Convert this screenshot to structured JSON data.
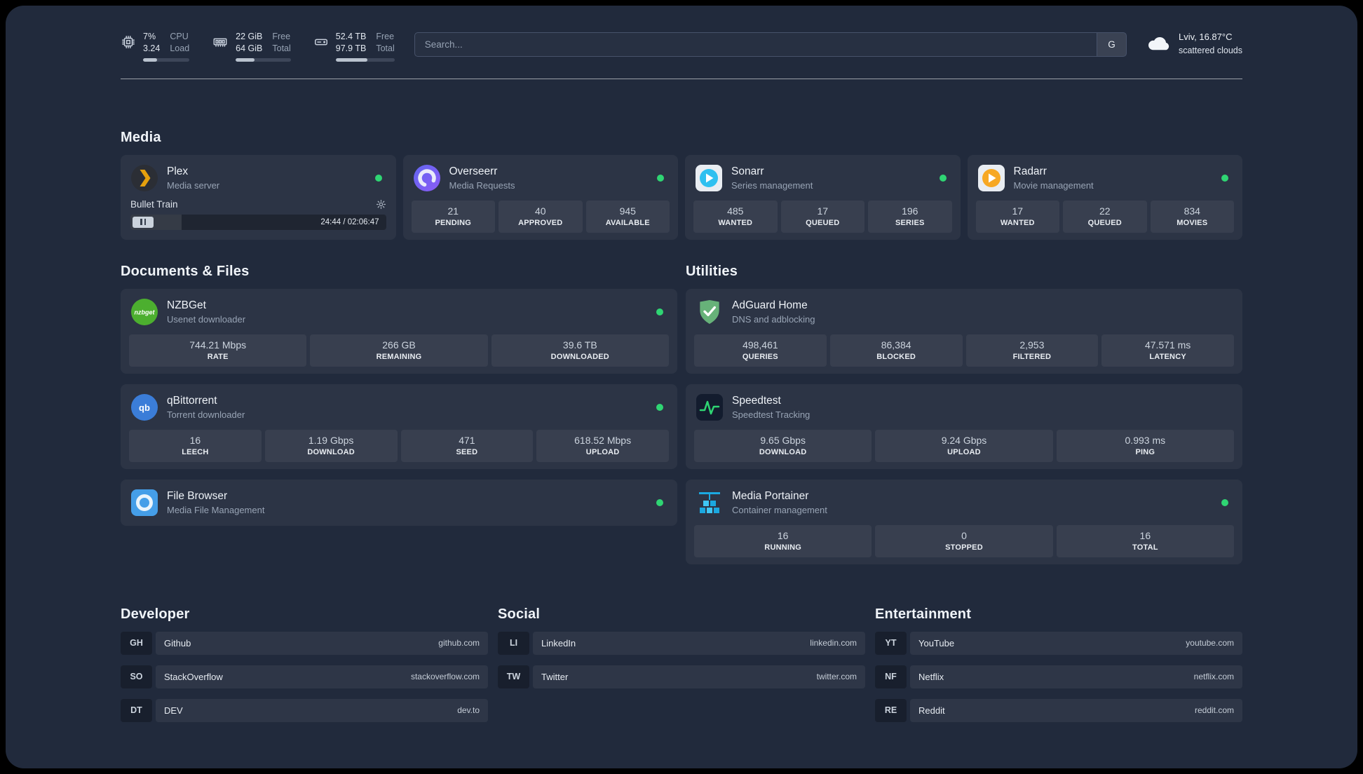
{
  "colors": {
    "status_online": "#2fd573",
    "page_background": "#212a3c",
    "plex_accent": "#e5a00d",
    "sonarr_accent": "#2ec0f0",
    "radarr_accent": "#f7a823",
    "nzbget_accent": "#4caf2f",
    "qbittorrent_accent": "#3b7dd8",
    "adguard_accent": "#67b279",
    "speedtest_accent": "#2fd573",
    "portainer_accent": "#1ba8e0"
  },
  "topbar": {
    "cpu": {
      "icon": "cpu-chip-icon",
      "value_top": "7%",
      "value_bottom": "3.24",
      "label_top": "CPU",
      "label_bottom": "Load",
      "bar_percent": 30
    },
    "memory": {
      "icon": "memory-icon",
      "value_top": "22 GiB",
      "value_bottom": "64 GiB",
      "label_top": "Free",
      "label_bottom": "Total",
      "bar_percent": 34
    },
    "disk": {
      "icon": "hard-drive-icon",
      "value_top": "52.4 TB",
      "value_bottom": "97.9 TB",
      "label_top": "Free",
      "label_bottom": "Total",
      "bar_percent": 54
    },
    "search": {
      "placeholder": "Search...",
      "provider_label": "G"
    },
    "weather": {
      "icon": "cloud-icon",
      "location": "Lviv, 16.87°C",
      "condition": "scattered clouds"
    }
  },
  "groups": {
    "media": {
      "title": "Media",
      "services": [
        {
          "name": "Plex",
          "subtitle": "Media server",
          "icon": "plex-icon",
          "status": "online",
          "player": {
            "title": "Bullet Train",
            "time": "24:44 / 02:06:47",
            "progress_percent": 20
          }
        },
        {
          "name": "Overseerr",
          "subtitle": "Media Requests",
          "icon": "overseerr-icon",
          "status": "online",
          "stats": [
            {
              "value": "21",
              "label": "PENDING"
            },
            {
              "value": "40",
              "label": "APPROVED"
            },
            {
              "value": "945",
              "label": "AVAILABLE"
            }
          ]
        },
        {
          "name": "Sonarr",
          "subtitle": "Series management",
          "icon": "sonarr-icon",
          "status": "online",
          "stats": [
            {
              "value": "485",
              "label": "WANTED"
            },
            {
              "value": "17",
              "label": "QUEUED"
            },
            {
              "value": "196",
              "label": "SERIES"
            }
          ]
        },
        {
          "name": "Radarr",
          "subtitle": "Movie management",
          "icon": "radarr-icon",
          "status": "online",
          "stats": [
            {
              "value": "17",
              "label": "WANTED"
            },
            {
              "value": "22",
              "label": "QUEUED"
            },
            {
              "value": "834",
              "label": "MOVIES"
            }
          ]
        }
      ]
    },
    "documents": {
      "title": "Documents & Files",
      "services": [
        {
          "name": "NZBGet",
          "subtitle": "Usenet downloader",
          "icon": "nzbget-icon",
          "icon_text": "nzbget",
          "status": "online",
          "stats": [
            {
              "value": "744.21 Mbps",
              "label": "RATE"
            },
            {
              "value": "266 GB",
              "label": "REMAINING"
            },
            {
              "value": "39.6 TB",
              "label": "DOWNLOADED"
            }
          ]
        },
        {
          "name": "qBittorrent",
          "subtitle": "Torrent downloader",
          "icon": "qbittorrent-icon",
          "icon_text": "qb",
          "status": "online",
          "stats": [
            {
              "value": "16",
              "label": "LEECH"
            },
            {
              "value": "1.19 Gbps",
              "label": "DOWNLOAD"
            },
            {
              "value": "471",
              "label": "SEED"
            },
            {
              "value": "618.52 Mbps",
              "label": "UPLOAD"
            }
          ]
        },
        {
          "name": "File Browser",
          "subtitle": "Media File Management",
          "icon": "filebrowser-icon",
          "status": "online",
          "stats": []
        }
      ]
    },
    "utilities": {
      "title": "Utilities",
      "services": [
        {
          "name": "AdGuard Home",
          "subtitle": "DNS and adblocking",
          "icon": "adguard-icon",
          "stats": [
            {
              "value": "498,461",
              "label": "QUERIES"
            },
            {
              "value": "86,384",
              "label": "BLOCKED"
            },
            {
              "value": "2,953",
              "label": "FILTERED"
            },
            {
              "value": "47.571 ms",
              "label": "LATENCY"
            }
          ]
        },
        {
          "name": "Speedtest",
          "subtitle": "Speedtest Tracking",
          "icon": "speedtest-icon",
          "stats": [
            {
              "value": "9.65 Gbps",
              "label": "DOWNLOAD"
            },
            {
              "value": "9.24 Gbps",
              "label": "UPLOAD"
            },
            {
              "value": "0.993 ms",
              "label": "PING"
            }
          ]
        },
        {
          "name": "Media Portainer",
          "subtitle": "Container management",
          "icon": "portainer-icon",
          "status": "online",
          "stats": [
            {
              "value": "16",
              "label": "RUNNING"
            },
            {
              "value": "0",
              "label": "STOPPED"
            },
            {
              "value": "16",
              "label": "TOTAL"
            }
          ]
        }
      ]
    }
  },
  "bookmarks": [
    {
      "title": "Developer",
      "items": [
        {
          "abbr": "GH",
          "name": "Github",
          "domain": "github.com"
        },
        {
          "abbr": "SO",
          "name": "StackOverflow",
          "domain": "stackoverflow.com"
        },
        {
          "abbr": "DT",
          "name": "DEV",
          "domain": "dev.to"
        }
      ]
    },
    {
      "title": "Social",
      "items": [
        {
          "abbr": "LI",
          "name": "LinkedIn",
          "domain": "linkedin.com"
        },
        {
          "abbr": "TW",
          "name": "Twitter",
          "domain": "twitter.com"
        }
      ]
    },
    {
      "title": "Entertainment",
      "items": [
        {
          "abbr": "YT",
          "name": "YouTube",
          "domain": "youtube.com"
        },
        {
          "abbr": "NF",
          "name": "Netflix",
          "domain": "netflix.com"
        },
        {
          "abbr": "RE",
          "name": "Reddit",
          "domain": "reddit.com"
        }
      ]
    }
  ]
}
